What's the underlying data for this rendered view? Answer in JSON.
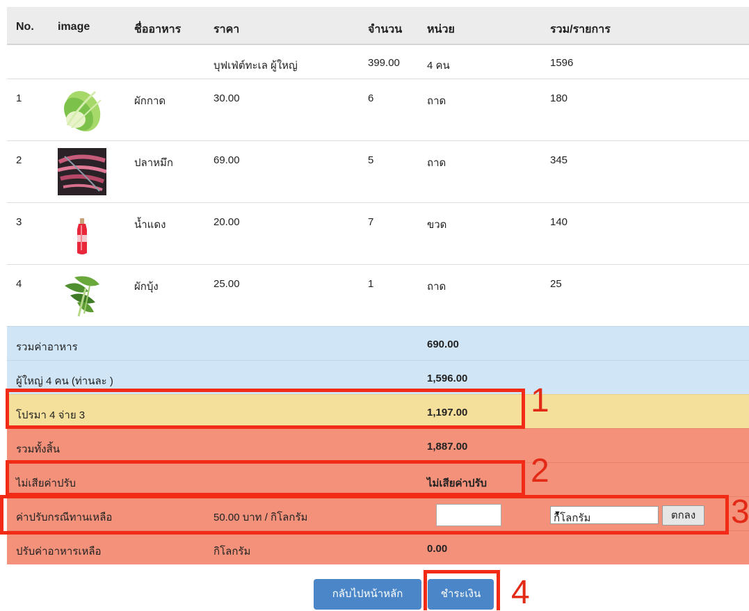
{
  "table": {
    "headers": [
      "No.",
      "image",
      "ชื่ออาหาร",
      "ราคา",
      "จำนวน",
      "หน่วย",
      "รวม/รายการ"
    ],
    "buffet": {
      "name": "บุฟเฟ่ต์ทะเล ผู้ใหญ่",
      "price": "399.00",
      "qty": "4 คน",
      "total": "1596"
    },
    "items": [
      {
        "no": "1",
        "image": "lettuce-image",
        "name": "ผักกาด",
        "price": "30.00",
        "qty": "6",
        "unit": "ถาด",
        "total": "180"
      },
      {
        "no": "2",
        "image": "squid-image",
        "name": "ปลาหมึก",
        "price": "69.00",
        "qty": "5",
        "unit": "ถาด",
        "total": "345"
      },
      {
        "no": "3",
        "image": "red-soda-bottle-image",
        "name": "น้ำแดง",
        "price": "20.00",
        "qty": "7",
        "unit": "ขวด",
        "total": "140"
      },
      {
        "no": "4",
        "image": "morning-glory-image",
        "name": "ผักบุ้ง",
        "price": "25.00",
        "qty": "1",
        "unit": "ถาด",
        "total": "25"
      }
    ]
  },
  "summary": {
    "food_total_label": "รวมค่าอาหาร",
    "food_total_value": "690.00",
    "adults_label": "ผู้ใหญ่ 4 คน (ท่านละ )",
    "adults_value": "1,596.00",
    "promo_label": "โปรมา 4 จ่าย 3",
    "promo_value": "1,197.00",
    "grand_label": "รวมทั้งสิ้น",
    "grand_value": "1,887.00",
    "penalty_status_label": "ไม่เสียค่าปรับ",
    "penalty_status_value": "ไม่เสียค่าปรับ",
    "leftover_label": "ค่าปรับกรณีทานเหลือ",
    "leftover_rate": "50.00 บาท / กิโลกรัม",
    "leftover_input_value": "",
    "leftover_unit_selected": "กิโลกรัม",
    "ok_button": "ตกลง",
    "leftover_fee_label": "ปรับค่าอาหารเหลือ",
    "leftover_fee_unit": "กิโลกรัม",
    "leftover_fee_value": "0.00"
  },
  "buttons": {
    "back": "กลับไปหน้าหลัก",
    "pay": "ชำระเงิน"
  },
  "annotations": [
    "1",
    "2",
    "3",
    "4"
  ],
  "colors": {
    "header": "#ececec",
    "blue_rows": "#d0e6f7",
    "promo_row": "#f4df9b",
    "red_rows": "#f3917b",
    "button": "#4a86c8",
    "highlight": "#f22b17"
  }
}
